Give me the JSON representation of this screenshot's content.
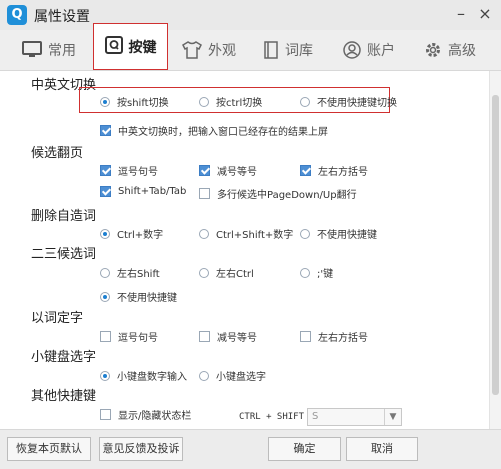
{
  "window": {
    "title": "属性设置",
    "logo_letter": "Q",
    "minimize": "–",
    "close": "×"
  },
  "tabs": [
    {
      "label": "常用",
      "icon": "monitor-icon"
    },
    {
      "label": "按键",
      "icon": "keyboard-q-icon",
      "active": true
    },
    {
      "label": "外观",
      "icon": "tshirt-icon"
    },
    {
      "label": "词库",
      "icon": "book-icon"
    },
    {
      "label": "账户",
      "icon": "user-circle-icon"
    },
    {
      "label": "高级",
      "icon": "gear-icon"
    }
  ],
  "sections": {
    "cn_en_switch": {
      "title": "中英文切换",
      "options": [
        "按shift切换",
        "按ctrl切换",
        "不使用快捷键切换"
      ],
      "selected": 0,
      "checkbox": {
        "label": "中英文切换时，把输入窗口已经存在的结果上屏",
        "checked": true
      }
    },
    "candidate_page": {
      "title": "候选翻页",
      "options": [
        {
          "label": "逗号句号",
          "checked": true
        },
        {
          "label": "减号等号",
          "checked": true
        },
        {
          "label": "左右方括号",
          "checked": true
        },
        {
          "label": "Shift+Tab/Tab",
          "checked": true
        },
        {
          "label": "多行候选中PageDown/Up翻行",
          "checked": false
        }
      ]
    },
    "delete_word": {
      "title": "删除自造词",
      "options": [
        "Ctrl+数字",
        "Ctrl+Shift+数字",
        "不使用快捷键"
      ],
      "selected": 0
    },
    "second_third": {
      "title": "二三候选词",
      "options": [
        "左右Shift",
        "左右Ctrl",
        ";'键",
        "不使用快捷键"
      ],
      "selected": 3
    },
    "word_select": {
      "title": "以词定字",
      "options": [
        {
          "label": "逗号句号",
          "checked": false
        },
        {
          "label": "减号等号",
          "checked": false
        },
        {
          "label": "左右方括号",
          "checked": false
        }
      ]
    },
    "numpad": {
      "title": "小键盘选字",
      "options": [
        "小键盘数字输入",
        "小键盘选字"
      ],
      "selected": 0
    },
    "other_hotkeys": {
      "title": "其他快捷键",
      "checkbox": {
        "label": "显示/隐藏状态栏",
        "checked": false
      },
      "hotkey_prefix": "CTRL + SHIFT +",
      "hotkey_value": "S"
    }
  },
  "footer": {
    "restore_default": "恢复本页默认",
    "feedback": "意见反馈及投诉",
    "ok": "确定",
    "cancel": "取消"
  },
  "colors": {
    "accent": "#1d7fd0",
    "highlight_border": "#d03030",
    "check_fill": "#4d8fd4"
  }
}
